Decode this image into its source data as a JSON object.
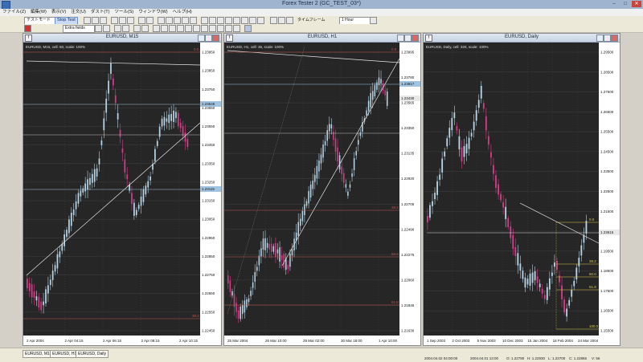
{
  "app": {
    "title": "Forex Tester 2  (GC_TEST_03*)"
  },
  "menu": [
    "ファイル(Z)",
    "編集(W)",
    "表示(V)",
    "注文(U)",
    "ダスト(T)",
    "ツール(S)",
    "ウィンドウ(W)",
    "ヘルプ(H)"
  ],
  "toolbar": {
    "mode_combo": "テストモード",
    "stop_test_label": "Stop Test",
    "extra_fields_combo": "Extra fields",
    "timeframe_label": "タイムフレーム",
    "timeframe_value": "1 Hour",
    "icons": [
      "new-chart-icon",
      "open-icon",
      "save-icon",
      "zoom-in-icon",
      "zoom-out-icon",
      "cursor-icon",
      "crosshair-icon",
      "line-icon",
      "horizontal-line-icon",
      "fibo-icon",
      "text-icon",
      "settings-icon"
    ]
  },
  "colors": {
    "chart_bg": "#262626",
    "bull": "#b7d5e6",
    "bear": "#d63b88",
    "grid": "#404040",
    "trend_line": "#e6e6e6",
    "fib_red": "#c0544e",
    "fib_yellow": "#d8c84a",
    "hline_blue": "#9fc3e0"
  },
  "charts": [
    {
      "title": "EURUSD, M15",
      "info": "EURUSD, M15, cell: 50, scale: 100%",
      "prices": [
        "1.23950",
        "1.23850",
        "1.23750",
        "1.23650",
        "1.23550",
        "1.23450",
        "1.23350",
        "1.23250",
        "1.23150",
        "1.23050",
        "1.22950",
        "1.22850",
        "1.22750",
        "1.22650",
        "1.22550",
        "1.22450"
      ],
      "price_tags": [
        "1.23545",
        "1.23115"
      ],
      "fib_labels": [
        "0.0",
        "38.2"
      ],
      "dates": [
        "2 Apr 2004",
        "2 Apr 04:15",
        "2 Apr 06:15",
        "2 Apr 08:15",
        "2 Apr 10:15"
      ]
    },
    {
      "title": "EURUSD, H1",
      "info": "EURUSD, H1, cell: 35, scale: 100%",
      "prices": [
        "1.23995",
        "1.23780",
        "1.23565",
        "1.23350",
        "1.23135",
        "1.22920",
        "1.22705",
        "1.22490",
        "1.22275",
        "1.22060",
        "1.21845",
        "1.21630"
      ],
      "price_tags": [
        "1.23817",
        "1.23430"
      ],
      "fib_labels": [
        "0.0",
        "38.2",
        "50.0",
        "61.8"
      ],
      "dates": [
        "25 Mar 2004",
        "26 Mar 10:00",
        "29 Mar 02:00",
        "30 Mar 18:00",
        "1 Apr 10:00"
      ]
    },
    {
      "title": "EURUSD, Daily",
      "info": "EURUSD, Daily, cell: 320, scale: 100%",
      "prices": [
        "1.29500",
        "1.28500",
        "1.27500",
        "1.26500",
        "1.25500",
        "1.24500",
        "1.23500",
        "1.22500",
        "1.21500",
        "1.20500",
        "1.19500",
        "1.18500",
        "1.17500",
        "1.16500",
        "1.15500"
      ],
      "price_tags": [
        "1.23615"
      ],
      "fib_labels": [
        "0.0",
        "38.2",
        "50.0",
        "61.8",
        "100.0"
      ],
      "dates": [
        "1 Sep 2003",
        "2 Oct 2003",
        "5 Nov 2003",
        "10 Dec 2003",
        "15 Jan 2004",
        "18 Feb 2004",
        "24 Mar 2004"
      ]
    }
  ],
  "status": {
    "tabs": [
      "EURUSD, M15",
      "EURUSD, H1",
      "EURUSD, Daily"
    ],
    "fields": [
      "2004.04.02 04:00:00",
      "2004.04.01 13:00",
      "O: 1.22780",
      "H: 1.22930",
      "L: 1.22700",
      "C: 1.22865",
      "V: 56"
    ]
  }
}
